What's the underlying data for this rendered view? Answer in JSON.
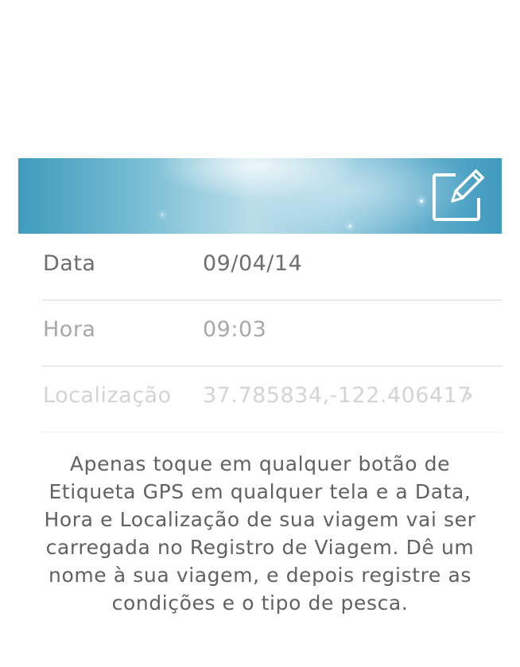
{
  "banner": {
    "edit_icon": "edit-note-icon"
  },
  "rows": [
    {
      "label": "Data",
      "value": "09/04/14"
    },
    {
      "label": "Hora",
      "value": "09:03"
    },
    {
      "label": "Localização",
      "value": "37.785834,-122.406417"
    }
  ],
  "description": "Apenas toque em qualquer botão de Etiqueta GPS em qualquer tela e a Data, Hora e Localização de sua viagem vai ser carregada no Registro de Viagem. Dê um nome à sua viagem, e depois registre as condições e o tipo de pesca."
}
